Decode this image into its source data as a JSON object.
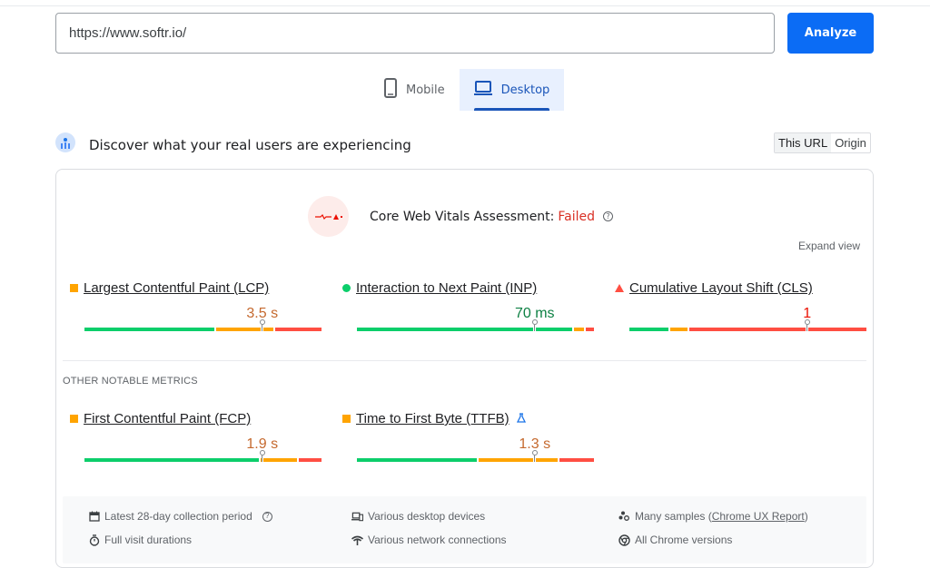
{
  "search": {
    "url_value": "https://www.softr.io/",
    "analyze_label": "Analyze"
  },
  "tabs": [
    {
      "label": "Mobile",
      "icon": "smartphone-icon",
      "active": false
    },
    {
      "label": "Desktop",
      "icon": "laptop-icon",
      "active": true
    }
  ],
  "discover": {
    "title": "Discover what your real users are experiencing",
    "scope_options": [
      "This URL",
      "Origin"
    ],
    "scope_selected": "This URL"
  },
  "assessment": {
    "label": "Core Web Vitals Assessment:",
    "status": "Failed",
    "status_color": "#d93025",
    "expand_label": "Expand view"
  },
  "core_metrics": [
    {
      "name": "Largest Contentful Paint (LCP)",
      "value": "3.5 s",
      "rating": "needs-improvement",
      "value_color": "#c5692e",
      "indicator": "square",
      "distribution": {
        "good": 0.55,
        "needs_improvement": 0.25,
        "poor": 0.2
      },
      "marker_percentile": 0.75
    },
    {
      "name": "Interaction to Next Paint (INP)",
      "value": "70 ms",
      "rating": "good",
      "value_color": "#0d8043",
      "indicator": "circle",
      "distribution": {
        "good": 0.91,
        "needs_improvement": 0.05,
        "poor": 0.04
      },
      "marker_percentile": 0.75
    },
    {
      "name": "Cumulative Layout Shift (CLS)",
      "value": "1",
      "rating": "poor",
      "value_color": "#eb0f00",
      "indicator": "triangle",
      "distribution": {
        "good": 0.17,
        "needs_improvement": 0.08,
        "poor": 0.75
      },
      "marker_percentile": 0.75
    }
  ],
  "other_title": "OTHER NOTABLE METRICS",
  "other_metrics": [
    {
      "name": "First Contentful Paint (FCP)",
      "value": "1.9 s",
      "rating": "needs-improvement",
      "value_color": "#c5692e",
      "indicator": "square",
      "experimental": false,
      "distribution": {
        "good": 0.74,
        "needs_improvement": 0.16,
        "poor": 0.1
      },
      "marker_percentile": 0.75
    },
    {
      "name": "Time to First Byte (TTFB)",
      "value": "1.3 s",
      "rating": "needs-improvement",
      "value_color": "#c5692e",
      "indicator": "square",
      "experimental": true,
      "distribution": {
        "good": 0.51,
        "needs_improvement": 0.34,
        "poor": 0.15
      },
      "marker_percentile": 0.75
    }
  ],
  "colors": {
    "good": "#0cce6b",
    "needs_improvement": "#ffa400",
    "poor": "#ff4e42",
    "accent": "#0b6cf5"
  },
  "footer": {
    "collection_period": "Latest 28-day collection period",
    "visit_durations": "Full visit durations",
    "devices": "Various desktop devices",
    "network": "Various network connections",
    "samples_prefix": "Many samples (",
    "samples_link": "Chrome UX Report",
    "samples_suffix": ")",
    "chrome_versions": "All Chrome versions"
  }
}
